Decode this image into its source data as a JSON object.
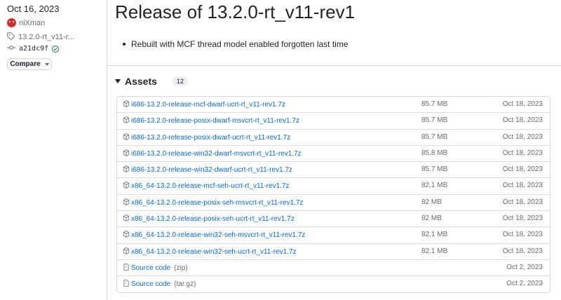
{
  "sidebar": {
    "date": "Oct 16, 2023",
    "author": "niXman",
    "tag": "13.2.0-rt_v11-r...",
    "commit": "a21dc9f",
    "compare_label": "Compare"
  },
  "release": {
    "title": "Release of 13.2.0-rt_v11-rev1",
    "notes": [
      "Rebuilt with MCF thread model enabled forgotten last time"
    ]
  },
  "assets": {
    "label": "Assets",
    "count": "12",
    "items": [
      {
        "name": "i686-13.2.0-release-mcf-dwarf-ucrt-rt_v11-rev1.7z",
        "suffix": "",
        "size": "85.7 MB",
        "date": "Oct 18, 2023",
        "icon": "package-icon"
      },
      {
        "name": "i686-13.2.0-release-posix-dwarf-msvcrt-rt_v11-rev1.7z",
        "suffix": "",
        "size": "85.7 MB",
        "date": "Oct 18, 2023",
        "icon": "package-icon"
      },
      {
        "name": "i686-13.2.0-release-posix-dwarf-ucrt-rt_v11-rev1.7z",
        "suffix": "",
        "size": "85.7 MB",
        "date": "Oct 18, 2023",
        "icon": "package-icon"
      },
      {
        "name": "i686-13.2.0-release-win32-dwarf-msvcrt-rt_v11-rev1.7z",
        "suffix": "",
        "size": "85.8 MB",
        "date": "Oct 18, 2023",
        "icon": "package-icon"
      },
      {
        "name": "i686-13.2.0-release-win32-dwarf-ucrt-rt_v11-rev1.7z",
        "suffix": "",
        "size": "85.7 MB",
        "date": "Oct 18, 2023",
        "icon": "package-icon"
      },
      {
        "name": "x86_64-13.2.0-release-mcf-seh-ucrt-rt_v11-rev1.7z",
        "suffix": "",
        "size": "82.1 MB",
        "date": "Oct 18, 2023",
        "icon": "package-icon"
      },
      {
        "name": "x86_64-13.2.0-release-posix-seh-msvcrt-rt_v11-rev1.7z",
        "suffix": "",
        "size": "82 MB",
        "date": "Oct 18, 2023",
        "icon": "package-icon"
      },
      {
        "name": "x86_64-13.2.0-release-posix-seh-ucrt-rt_v11-rev1.7z",
        "suffix": "",
        "size": "82 MB",
        "date": "Oct 18, 2023",
        "icon": "package-icon"
      },
      {
        "name": "x86_64-13.2.0-release-win32-seh-msvcrt-rt_v11-rev1.7z",
        "suffix": "",
        "size": "82.1 MB",
        "date": "Oct 18, 2023",
        "icon": "package-icon"
      },
      {
        "name": "x86_64-13.2.0-release-win32-seh-ucrt-rt_v11-rev1.7z",
        "suffix": "",
        "size": "82.1 MB",
        "date": "Oct 18, 2023",
        "icon": "package-icon"
      },
      {
        "name": "Source code",
        "suffix": "(zip)",
        "size": "",
        "date": "Oct 2, 2023",
        "icon": "file-zip-icon"
      },
      {
        "name": "Source code",
        "suffix": "(tar.gz)",
        "size": "",
        "date": "Oct 2, 2023",
        "icon": "file-zip-icon"
      }
    ]
  },
  "colors": {
    "link": "#0969da",
    "muted": "#656d76",
    "border": "#d0d7de",
    "success": "#1a7f37"
  }
}
